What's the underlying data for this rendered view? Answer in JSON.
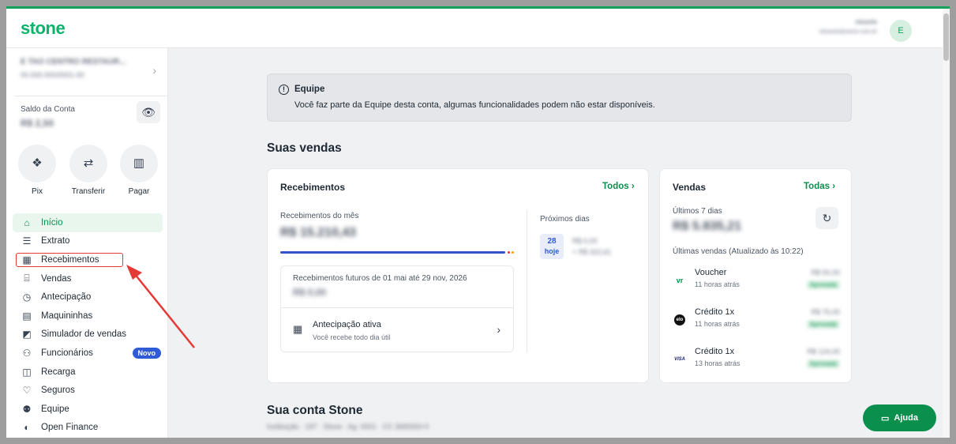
{
  "brand": {
    "logo": "stone",
    "accent": "#0a8f4d"
  },
  "user": {
    "name": "eduardo",
    "email": "eduardo@stone.com.br",
    "initial": "E"
  },
  "sidebar": {
    "company_name": "E TAO CENTRO RESTAUR...",
    "company_doc": "00.000.000/0001-00",
    "saldo_label": "Saldo da Conta",
    "saldo_value": "R$ 2,50",
    "quick_actions": [
      {
        "label": "Pix",
        "icon": "pix-icon"
      },
      {
        "label": "Transferir",
        "icon": "transfer-icon"
      },
      {
        "label": "Pagar",
        "icon": "barcode-icon"
      }
    ],
    "nav": [
      {
        "label": "Início",
        "icon": "home-icon",
        "glyph": "⌂"
      },
      {
        "label": "Extrato",
        "icon": "statement-icon",
        "glyph": "☰"
      },
      {
        "label": "Recebimentos",
        "icon": "calendar-money-icon",
        "glyph": "▦"
      },
      {
        "label": "Vendas",
        "icon": "store-icon",
        "glyph": "⌸"
      },
      {
        "label": "Antecipação",
        "icon": "clock-icon",
        "glyph": "◷"
      },
      {
        "label": "Maquininhas",
        "icon": "card-machine-icon",
        "glyph": "▤"
      },
      {
        "label": "Simulador de vendas",
        "icon": "simulator-icon",
        "glyph": "◩"
      },
      {
        "label": "Funcionários",
        "icon": "employees-icon",
        "glyph": "⚇",
        "badge": "Novo"
      },
      {
        "label": "Recarga",
        "icon": "recharge-icon",
        "glyph": "◫"
      },
      {
        "label": "Seguros",
        "icon": "heart-icon",
        "glyph": "♡"
      },
      {
        "label": "Equipe",
        "icon": "team-icon",
        "glyph": "⚉"
      },
      {
        "label": "Open Finance",
        "icon": "open-finance-icon",
        "glyph": "◐"
      }
    ]
  },
  "alert": {
    "title": "Equipe",
    "text": "Você faz parte da Equipe desta conta, algumas funcionalidades podem não estar disponíveis."
  },
  "sales_section_title": "Suas vendas",
  "receipts_card": {
    "title": "Recebimentos",
    "link": "Todos",
    "month_label": "Recebimentos do mês",
    "month_value": "R$ 15.210,43",
    "future_label": "Recebimentos futuros de 01 mai até 29 nov, 2026",
    "future_value": "R$ 0,00",
    "antecipation_title": "Antecipação ativa",
    "antecipation_sub": "Você recebe todo dia útil",
    "next_days_label": "Próximos dias",
    "next_day": "28",
    "next_day_label": "hoje",
    "next_value": "R$ 0,00",
    "next_value_sub": "+ R$ 322,61"
  },
  "sales_card": {
    "title": "Vendas",
    "link": "Todas",
    "period_label": "Últimos 7 dias",
    "period_value": "R$ 5.835,21",
    "last_sales_label": "Últimas vendas (Atualizado às 10:22)",
    "sales": [
      {
        "name": "Voucher",
        "time": "11 horas atrás",
        "value": "R$ 50,00",
        "status": "Aprovada",
        "logo": "vr",
        "logo_icon": "voucher-logo-icon"
      },
      {
        "name": "Crédito 1x",
        "time": "11 horas atrás",
        "value": "R$ 75,00",
        "status": "Aprovada",
        "logo": "elo",
        "logo_icon": "elo-logo-icon"
      },
      {
        "name": "Crédito 1x",
        "time": "13 horas atrás",
        "value": "R$ 124,00",
        "status": "Aprovada",
        "logo": "VISA",
        "logo_icon": "visa-logo-icon"
      }
    ]
  },
  "account_section_title": "Sua conta Stone",
  "account_sub": "Instituição · 197 · Stone · Ag. 0001 · CC 3665920-0",
  "help_button": "Ajuda"
}
